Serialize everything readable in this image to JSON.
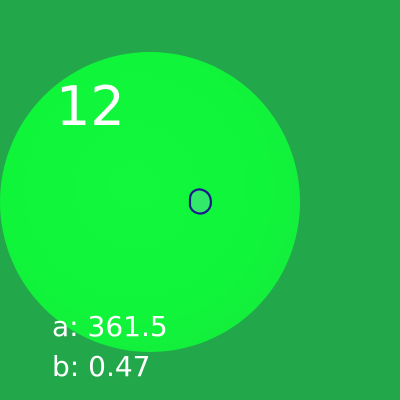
{
  "colors": {
    "background": "#22a84a",
    "disc": "#0ff53a",
    "marker_outline": "#1a1a8c",
    "text": "#ffffff"
  },
  "frame": {
    "index": "12"
  },
  "metrics": {
    "a_label": "a:",
    "a_value": "361.5",
    "b_label": "b:",
    "b_value": "0.47"
  },
  "icons": {
    "disc": "circular-region",
    "marker": "ring-marker-icon"
  }
}
